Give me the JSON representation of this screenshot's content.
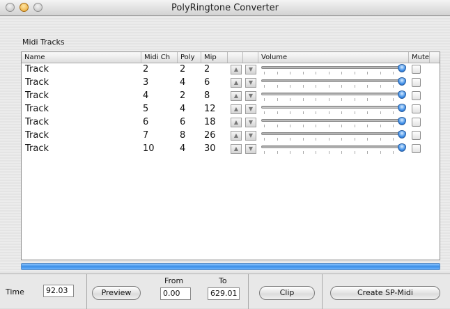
{
  "window": {
    "title": "PolyRingtone Converter"
  },
  "midi_tracks": {
    "section_label": "Midi Tracks",
    "columns": [
      "Name",
      "Midi Ch",
      "Poly",
      "Mip",
      "",
      "",
      "Volume",
      "Mute"
    ],
    "rows": [
      {
        "name": "Track",
        "midi_ch": "2",
        "poly": "2",
        "mip": "2",
        "volume": 1.0,
        "muted": false
      },
      {
        "name": "Track",
        "midi_ch": "3",
        "poly": "4",
        "mip": "6",
        "volume": 1.0,
        "muted": false
      },
      {
        "name": "Track",
        "midi_ch": "4",
        "poly": "2",
        "mip": "8",
        "volume": 1.0,
        "muted": false
      },
      {
        "name": "Track",
        "midi_ch": "5",
        "poly": "4",
        "mip": "12",
        "volume": 1.0,
        "muted": false
      },
      {
        "name": "Track",
        "midi_ch": "6",
        "poly": "6",
        "mip": "18",
        "volume": 1.0,
        "muted": false
      },
      {
        "name": "Track",
        "midi_ch": "7",
        "poly": "8",
        "mip": "26",
        "volume": 1.0,
        "muted": false
      },
      {
        "name": "Track",
        "midi_ch": "10",
        "poly": "4",
        "mip": "30",
        "volume": 1.0,
        "muted": false
      }
    ],
    "up_arrow": "▲",
    "down_arrow": "▼"
  },
  "progress": {
    "fraction": 1.0
  },
  "bottom": {
    "time_label": "Time",
    "time_value": "92.03",
    "preview_label": "Preview",
    "from_label": "From",
    "from_value": "0.00",
    "to_label": "To",
    "to_value": "629.01",
    "clip_label": "Clip",
    "create_label": "Create SP-Midi"
  },
  "colors": {
    "accent": "#3b8ee6"
  }
}
